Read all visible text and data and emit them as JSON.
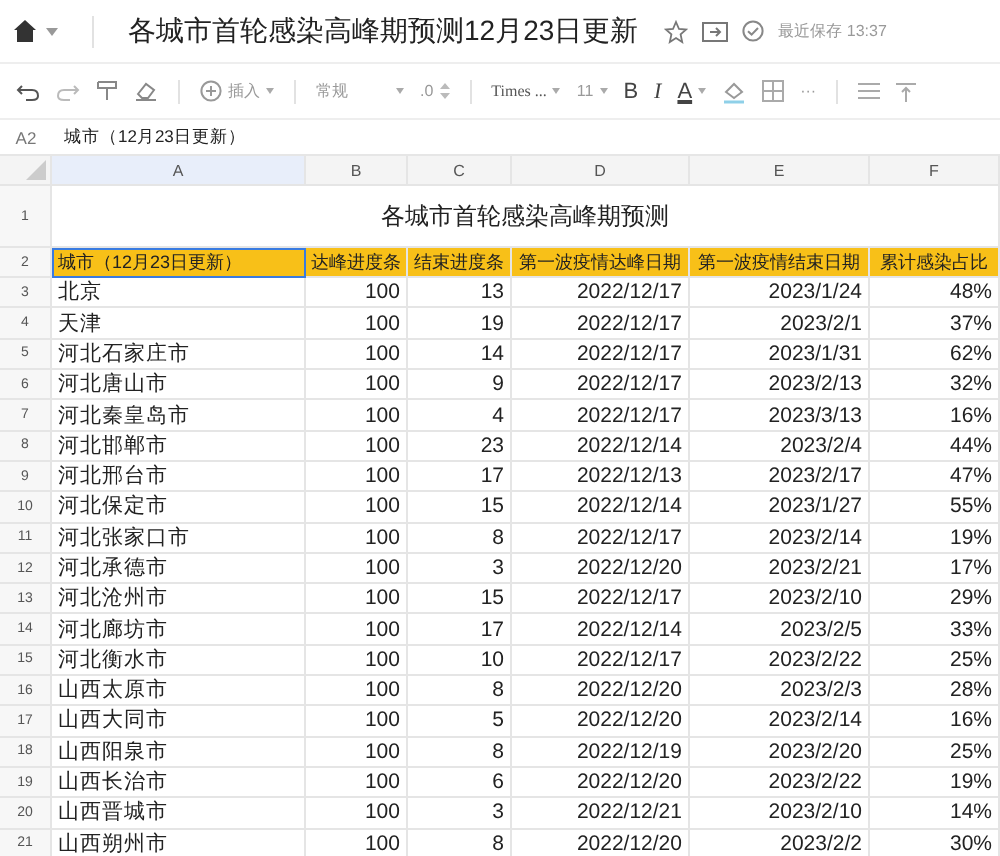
{
  "app": {
    "title": "各城市首轮感染高峰期预测12月23日更新",
    "save_status": "最近保存 13:37"
  },
  "toolbar": {
    "insert": "插入",
    "number_format": "常规",
    "decimals": ".0",
    "font": "Times ...",
    "font_size": "11",
    "bold": "B",
    "italic": "I",
    "font_color": "A",
    "more": "···"
  },
  "formula_bar": {
    "cell": "A2",
    "value": "城市（12月23日更新）"
  },
  "columns": [
    {
      "label": "A",
      "selected": true
    },
    {
      "label": "B",
      "selected": false
    },
    {
      "label": "C",
      "selected": false
    },
    {
      "label": "D",
      "selected": false
    },
    {
      "label": "E",
      "selected": false
    },
    {
      "label": "F",
      "selected": false
    }
  ],
  "sheet": {
    "title_row": "1",
    "title": "各城市首轮感染高峰期预测",
    "header_row": "2",
    "headers": [
      {
        "text": "城市（12月23日更新）",
        "selected": true
      },
      {
        "text": "达峰进度条",
        "selected": false
      },
      {
        "text": "结束进度条",
        "selected": false
      },
      {
        "text": "第一波疫情达峰日期",
        "selected": false
      },
      {
        "text": "第一波疫情结束日期",
        "selected": false
      },
      {
        "text": "累计感染占比",
        "selected": false
      }
    ],
    "rows": [
      {
        "num": "3",
        "cells": [
          "北京",
          "100",
          "13",
          "2022/12/17",
          "2023/1/24",
          "48%"
        ]
      },
      {
        "num": "4",
        "cells": [
          "天津",
          "100",
          "19",
          "2022/12/17",
          "2023/2/1",
          "37%"
        ]
      },
      {
        "num": "5",
        "cells": [
          "河北石家庄市",
          "100",
          "14",
          "2022/12/17",
          "2023/1/31",
          "62%"
        ]
      },
      {
        "num": "6",
        "cells": [
          "河北唐山市",
          "100",
          "9",
          "2022/12/17",
          "2023/2/13",
          "32%"
        ]
      },
      {
        "num": "7",
        "cells": [
          "河北秦皇岛市",
          "100",
          "4",
          "2022/12/17",
          "2023/3/13",
          "16%"
        ]
      },
      {
        "num": "8",
        "cells": [
          "河北邯郸市",
          "100",
          "23",
          "2022/12/14",
          "2023/2/4",
          "44%"
        ]
      },
      {
        "num": "9",
        "cells": [
          "河北邢台市",
          "100",
          "17",
          "2022/12/13",
          "2023/2/17",
          "47%"
        ]
      },
      {
        "num": "10",
        "cells": [
          "河北保定市",
          "100",
          "15",
          "2022/12/14",
          "2023/1/27",
          "55%"
        ]
      },
      {
        "num": "11",
        "cells": [
          "河北张家口市",
          "100",
          "8",
          "2022/12/17",
          "2023/2/14",
          "19%"
        ]
      },
      {
        "num": "12",
        "cells": [
          "河北承德市",
          "100",
          "3",
          "2022/12/20",
          "2023/2/21",
          "17%"
        ]
      },
      {
        "num": "13",
        "cells": [
          "河北沧州市",
          "100",
          "15",
          "2022/12/17",
          "2023/2/10",
          "29%"
        ]
      },
      {
        "num": "14",
        "cells": [
          "河北廊坊市",
          "100",
          "17",
          "2022/12/14",
          "2023/2/5",
          "33%"
        ]
      },
      {
        "num": "15",
        "cells": [
          "河北衡水市",
          "100",
          "10",
          "2022/12/17",
          "2023/2/22",
          "25%"
        ]
      },
      {
        "num": "16",
        "cells": [
          "山西太原市",
          "100",
          "8",
          "2022/12/20",
          "2023/2/3",
          "28%"
        ]
      },
      {
        "num": "17",
        "cells": [
          "山西大同市",
          "100",
          "5",
          "2022/12/20",
          "2023/2/14",
          "16%"
        ]
      },
      {
        "num": "18",
        "cells": [
          "山西阳泉市",
          "100",
          "8",
          "2022/12/19",
          "2023/2/20",
          "25%"
        ]
      },
      {
        "num": "19",
        "cells": [
          "山西长治市",
          "100",
          "6",
          "2022/12/20",
          "2023/2/22",
          "19%"
        ]
      },
      {
        "num": "20",
        "cells": [
          "山西晋城市",
          "100",
          "3",
          "2022/12/21",
          "2023/2/10",
          "14%"
        ]
      },
      {
        "num": "21",
        "cells": [
          "山西朔州市",
          "100",
          "8",
          "2022/12/20",
          "2023/2/2",
          "30%"
        ]
      }
    ]
  }
}
